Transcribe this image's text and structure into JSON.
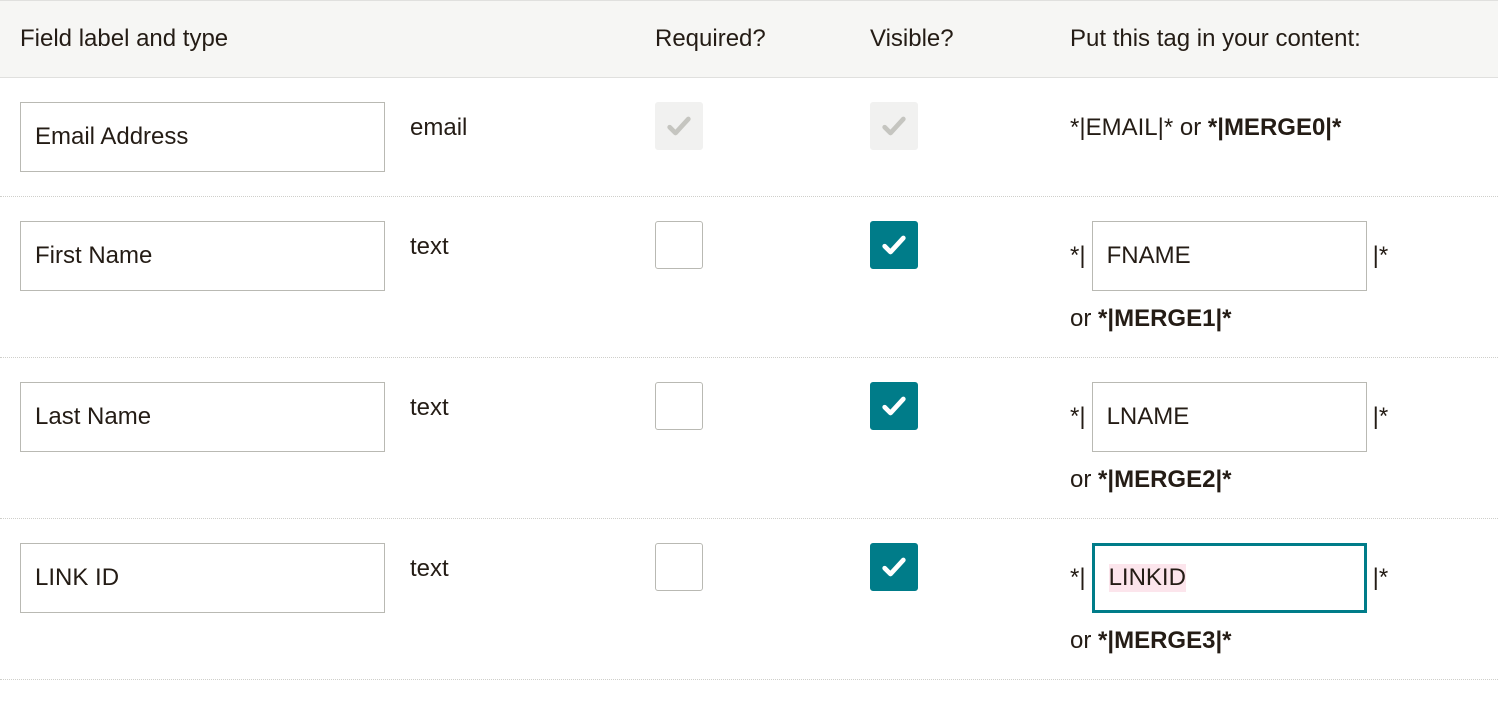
{
  "headers": {
    "label": "Field label and type",
    "required": "Required?",
    "visible": "Visible?",
    "tag": "Put this tag in your content:"
  },
  "delim_open": "*|",
  "delim_close": "|*",
  "or_word": "or",
  "rows": [
    {
      "label": "Email Address",
      "type": "email",
      "required_checked": true,
      "required_disabled": true,
      "visible_checked": true,
      "visible_disabled": true,
      "tag_editable": false,
      "tag_primary": "EMAIL",
      "tag_merge": "MERGE0",
      "tag_focused": false
    },
    {
      "label": "First Name",
      "type": "text",
      "required_checked": false,
      "required_disabled": false,
      "visible_checked": true,
      "visible_disabled": false,
      "tag_editable": true,
      "tag_primary": "FNAME",
      "tag_merge": "MERGE1",
      "tag_focused": false
    },
    {
      "label": "Last Name",
      "type": "text",
      "required_checked": false,
      "required_disabled": false,
      "visible_checked": true,
      "visible_disabled": false,
      "tag_editable": true,
      "tag_primary": "LNAME",
      "tag_merge": "MERGE2",
      "tag_focused": false
    },
    {
      "label": "LINK ID",
      "type": "text",
      "required_checked": false,
      "required_disabled": false,
      "visible_checked": true,
      "visible_disabled": false,
      "tag_editable": true,
      "tag_primary": "LINKID",
      "tag_merge": "MERGE3",
      "tag_focused": true
    }
  ]
}
